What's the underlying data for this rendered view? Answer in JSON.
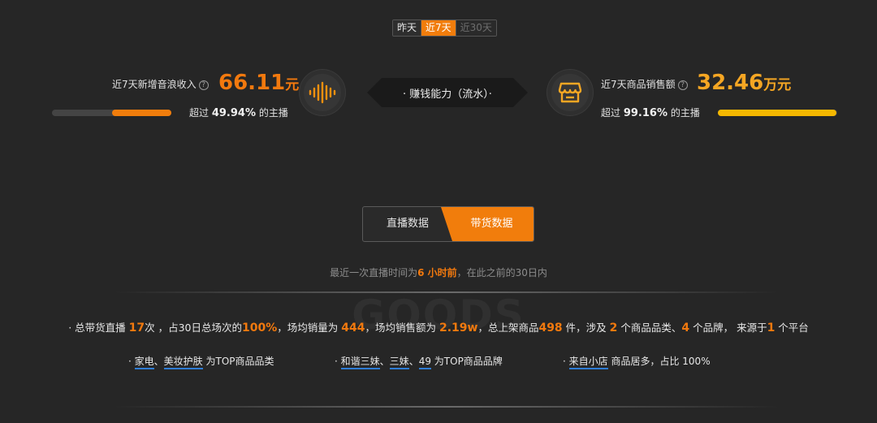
{
  "period_tabs": [
    "昨天",
    "近7天",
    "近30天"
  ],
  "period_selected": "近7天",
  "left_metric": {
    "label": "近7天新增音浪收入",
    "value": "66.11",
    "unit": "元",
    "exceed_prefix": "超过",
    "exceed_value": "49.94%",
    "exceed_suffix": "的主播",
    "percentile": 49.94
  },
  "center_banner": "· 赚钱能力（流水）·",
  "right_metric": {
    "label": "近7天商品销售额",
    "value": "32.46",
    "unit": "万元",
    "exceed_prefix": "超过",
    "exceed_value": "99.16%",
    "exceed_suffix": "的主播",
    "percentile": 99.16
  },
  "data_tabs": {
    "live": "直播数据",
    "goods": "带货数据",
    "selected": "goods"
  },
  "notice": {
    "prefix": "最近一次直播时间为",
    "time": "6 小时前",
    "suffix": "，在此之前的30日内"
  },
  "watermark": "GOODS",
  "summary": {
    "p1": "· 总带货直播 ",
    "live_count": "17",
    "p2": "次 ，占30日总场次的",
    "ratio": "100%",
    "p3": "，场均销量为 ",
    "avg_sales": "444",
    "p4": "，场均销售额为 ",
    "avg_amount": "2.19w",
    "p5": "，总上架商品",
    "products": "498",
    "p6": " 件，涉及 ",
    "categories": "2",
    "p7": " 个商品品类、",
    "brands": "4",
    "p8": " 个品牌，  来源于",
    "platforms": "1",
    "p9": " 个平台"
  },
  "tags": {
    "category": {
      "prefix": "· ",
      "item1": "家电",
      "sep": "、",
      "item2": "美妆护肤",
      "suffix": " 为TOP商品品类"
    },
    "brand": {
      "prefix": "· ",
      "item1": "和谐三妹",
      "sep1": "、",
      "item2": "三妹",
      "sep2": "、",
      "item3": "49",
      "suffix": " 为TOP商品品牌"
    },
    "source": {
      "prefix": "· ",
      "item1": "来自小店",
      "suffix": " 商品居多，占比 100%"
    }
  },
  "colors": {
    "accent": "#f17d0c",
    "gold": "#f5a623",
    "background": "#262626",
    "underline": "#2f7dd6"
  },
  "icons": {
    "left": "sound-wave-icon",
    "right": "shop-icon",
    "help": "question-circle-icon"
  }
}
